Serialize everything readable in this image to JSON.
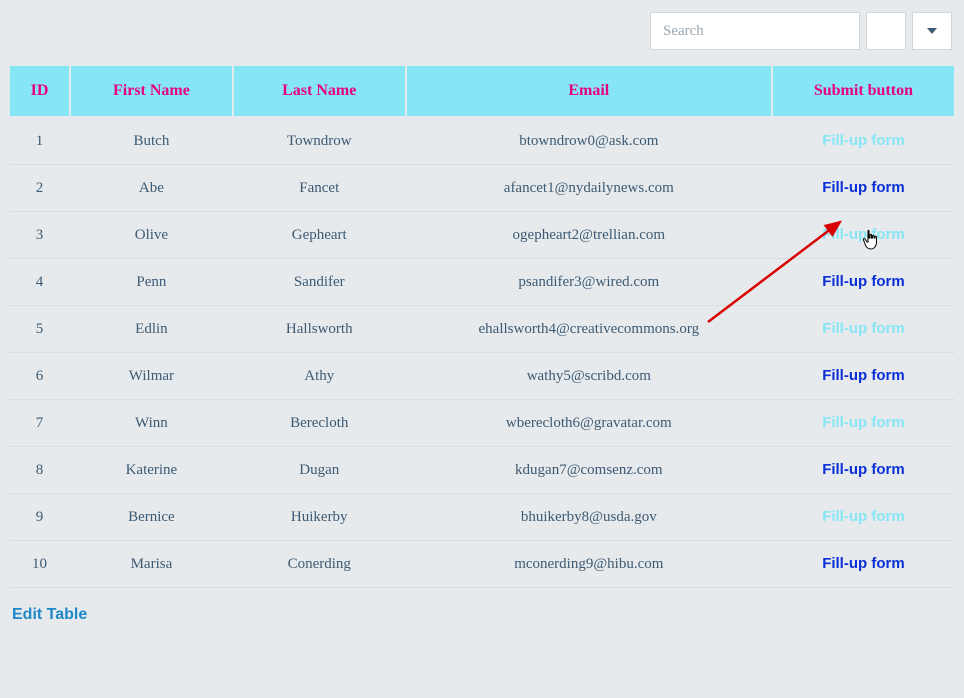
{
  "toolbar": {
    "search_placeholder": "Search"
  },
  "columns": {
    "id": "ID",
    "first_name": "First Name",
    "last_name": "Last Name",
    "email": "Email",
    "submit": "Submit button"
  },
  "rows": [
    {
      "id": "1",
      "first_name": "Butch",
      "last_name": "Towndrow",
      "email": "btowndrow0@ask.com",
      "action": "Fill-up form",
      "style": "light"
    },
    {
      "id": "2",
      "first_name": "Abe",
      "last_name": "Fancet",
      "email": "afancet1@nydailynews.com",
      "action": "Fill-up form",
      "style": "dark"
    },
    {
      "id": "3",
      "first_name": "Olive",
      "last_name": "Gepheart",
      "email": "ogepheart2@trellian.com",
      "action": "Fill-up form",
      "style": "light"
    },
    {
      "id": "4",
      "first_name": "Penn",
      "last_name": "Sandifer",
      "email": "psandifer3@wired.com",
      "action": "Fill-up form",
      "style": "dark"
    },
    {
      "id": "5",
      "first_name": "Edlin",
      "last_name": "Hallsworth",
      "email": "ehallsworth4@creativecommons.org",
      "action": "Fill-up form",
      "style": "light"
    },
    {
      "id": "6",
      "first_name": "Wilmar",
      "last_name": "Athy",
      "email": "wathy5@scribd.com",
      "action": "Fill-up form",
      "style": "dark"
    },
    {
      "id": "7",
      "first_name": "Winn",
      "last_name": "Berecloth",
      "email": "wberecloth6@gravatar.com",
      "action": "Fill-up form",
      "style": "light"
    },
    {
      "id": "8",
      "first_name": "Katerine",
      "last_name": "Dugan",
      "email": "kdugan7@comsenz.com",
      "action": "Fill-up form",
      "style": "dark"
    },
    {
      "id": "9",
      "first_name": "Bernice",
      "last_name": "Huikerby",
      "email": "bhuikerby8@usda.gov",
      "action": "Fill-up form",
      "style": "light"
    },
    {
      "id": "10",
      "first_name": "Marisa",
      "last_name": "Conerding",
      "email": "mconerding9@hibu.com",
      "action": "Fill-up form",
      "style": "dark"
    }
  ],
  "footer": {
    "edit_table": "Edit Table"
  }
}
